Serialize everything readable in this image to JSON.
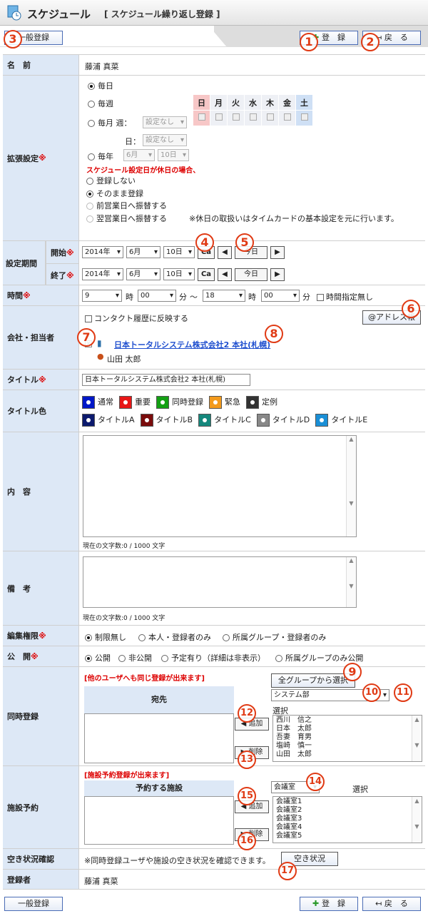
{
  "header": {
    "title": "スケジュール",
    "subtitle": "[ スケジュール繰り返し登録 ]"
  },
  "toolbar": {
    "normal_reg": "一般登録",
    "register": "登　録",
    "back": "戻　る"
  },
  "callouts": [
    "1",
    "2",
    "3",
    "4",
    "5",
    "6",
    "7",
    "8",
    "9",
    "10",
    "11",
    "12",
    "13",
    "14",
    "15",
    "16",
    "17"
  ],
  "name": {
    "label": "名　前",
    "value": "藤浦 真菜"
  },
  "ext": {
    "label": "拡張設定",
    "req": "※",
    "daily": "毎日",
    "weekly": "毎週",
    "monthly": "毎月",
    "week_label": "週：",
    "day_label": "日：",
    "none": "設定なし",
    "yearly": "毎年",
    "month": "6月",
    "day": "10日",
    "weekdays": [
      "日",
      "月",
      "火",
      "水",
      "木",
      "金",
      "土"
    ],
    "holiday_note": "スケジュール設定日が休日の場合、",
    "opt1": "登録しない",
    "opt2": "そのまま登録",
    "opt3": "前営業日へ振替する",
    "opt4": "翌営業日へ振替する",
    "note": "※休日の取扱いはタイムカードの基本設定を元に行います。"
  },
  "period": {
    "label": "設定期間",
    "start": "開始",
    "end": "終了",
    "req": "※",
    "year": "2014年",
    "month": "6月",
    "day": "10日",
    "cal": "Ca",
    "today": "今日",
    "prev": "◀",
    "next": "▶"
  },
  "time": {
    "label": "時間",
    "req": "※",
    "h1": "9",
    "m1": "00",
    "h2": "18",
    "m2": "00",
    "hour": "時",
    "min": "分",
    "tilde": "～",
    "no_time": "時間指定無し"
  },
  "company": {
    "label": "会社・担当者",
    "reflect": "コンタクト履歴に反映する",
    "addr_btn": "@アドレス帳",
    "company_name": "日本トータルシステム株式会社2 本社(札幌)",
    "person": "山田 太郎"
  },
  "title_row": {
    "label": "タイトル",
    "req": "※",
    "value": "日本トータルシステム株式会社2 本社(札幌)"
  },
  "color": {
    "label": "タイトル色",
    "items": [
      {
        "name": "通常",
        "c": "#0018c8"
      },
      {
        "name": "重要",
        "c": "#e81818"
      },
      {
        "name": "同時登録",
        "c": "#14a014"
      },
      {
        "name": "緊急",
        "c": "#f39a1c"
      },
      {
        "name": "定例",
        "c": "#333333"
      },
      {
        "name": "タイトルA",
        "c": "#0c1a6e"
      },
      {
        "name": "タイトルB",
        "c": "#7a0c0c"
      },
      {
        "name": "タイトルC",
        "c": "#15877c"
      },
      {
        "name": "タイトルD",
        "c": "#888888"
      },
      {
        "name": "タイトルE",
        "c": "#1a8fd6"
      }
    ]
  },
  "content": {
    "label": "内　容",
    "count": "現在の文字数:0 / 1000 文字"
  },
  "remarks": {
    "label": "備　考",
    "count": "現在の文字数:0 / 1000 文字"
  },
  "perm": {
    "label": "編集権限",
    "req": "※",
    "o1": "制限無し",
    "o2": "本人・登録者のみ",
    "o3": "所属グループ・登録者のみ"
  },
  "pub": {
    "label": "公　開",
    "req": "※",
    "o1": "公開",
    "o2": "非公開",
    "o3": "予定有り（詳細は非表示）",
    "o4": "所属グループのみ公開"
  },
  "simul": {
    "label": "同時登録",
    "note": "[他のユーザへも同じ登録が出来ます]",
    "dest": "宛先",
    "all_groups": "全グループから選択",
    "group": "システム部",
    "select": "選択",
    "add": "追加",
    "del": "削除",
    "users": [
      "西川　信之",
      "日本　太郎",
      "吾妻　育男",
      "塩崎　慎一",
      "山田　太郎"
    ]
  },
  "facility": {
    "label": "施設予約",
    "note": "[施設予約登録が出来ます]",
    "head": "予約する施設",
    "group": "会議室",
    "select": "選択",
    "add": "追加",
    "del": "削除",
    "rooms": [
      "会議室1",
      "会議室2",
      "会議室3",
      "会議室4",
      "会議室5"
    ]
  },
  "vacancy": {
    "label": "空き状況確認",
    "note": "※同時登録ユーザや施設の空き状況を確認できます。",
    "btn": "空き状況"
  },
  "registrant": {
    "label": "登録者",
    "value": "藤浦 真菜"
  }
}
